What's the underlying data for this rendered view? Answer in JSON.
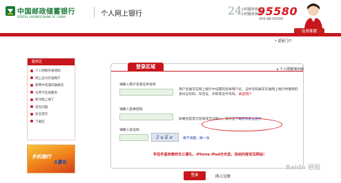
{
  "header": {
    "bank_name_cn": "中国邮政储蓄银行",
    "bank_name_en": "POSTAL SAVINGS BANK OF CHINA",
    "portal_title": "个人网上银行",
    "service_hours": "24",
    "service_label_1": "小时服务热线",
    "service_label_2": "小时服务热线",
    "hotline": "95580",
    "hotline_alt": "400-88-95580",
    "online_cs_label": "在线客服",
    "back_link": "返回门户"
  },
  "sidebar": {
    "title": "服务区",
    "items": [
      "个人网银开通须知",
      "网上支付开通用户",
      "使用中常遇问题解答",
      "信用卡在线服务",
      "新功能上线了",
      "常见问题",
      "安全提示",
      "下载区"
    ],
    "promo_line_1": "手机银行",
    "promo_line_2": "3重礼"
  },
  "login": {
    "tab_title": "登录区域",
    "demo_link": "个人网银演示版",
    "username_label": "请输入用户名或证件号码",
    "username_value": "",
    "username_note": "用户名填写在网上银行中设置的登录用户名，证件号码填写开通网上银行时使用的身份证号码、军官证、护照等证件号码。",
    "username_note_link": "请选用户",
    "password_label": "请输入登录密码",
    "password_value": "",
    "password_note": "如果您是首次登录或无法输入，请点击",
    "download_link": "下载密码安全控件",
    "captcha_label": "请输入验证码",
    "captcha_value": "",
    "captcha_image_text": "3uEe",
    "refresh_link": "看不清楚，换一张",
    "promo_text": "手拉手星四季欢乐三重礼，iPhone iPad天天送，活动内容详见网站！",
    "login_button": "登录",
    "register_link": "网上注册"
  },
  "watermark": "Baidu 经验"
}
